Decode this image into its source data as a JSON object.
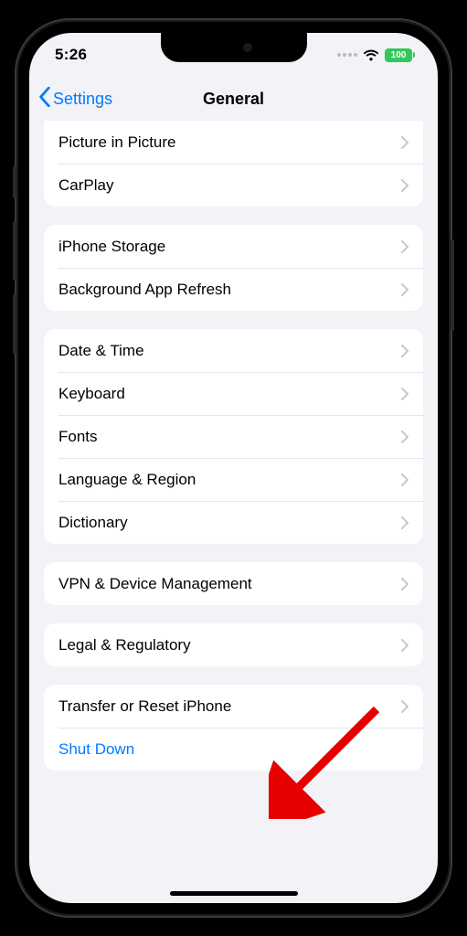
{
  "status": {
    "time": "5:26",
    "battery": "100"
  },
  "nav": {
    "back": "Settings",
    "title": "General"
  },
  "groups": [
    {
      "first": true,
      "items": [
        {
          "label": "Picture in Picture",
          "chevron": true
        },
        {
          "label": "CarPlay",
          "chevron": true
        }
      ]
    },
    {
      "items": [
        {
          "label": "iPhone Storage",
          "chevron": true
        },
        {
          "label": "Background App Refresh",
          "chevron": true
        }
      ]
    },
    {
      "items": [
        {
          "label": "Date & Time",
          "chevron": true
        },
        {
          "label": "Keyboard",
          "chevron": true
        },
        {
          "label": "Fonts",
          "chevron": true
        },
        {
          "label": "Language & Region",
          "chevron": true
        },
        {
          "label": "Dictionary",
          "chevron": true
        }
      ]
    },
    {
      "items": [
        {
          "label": "VPN & Device Management",
          "chevron": true
        }
      ]
    },
    {
      "items": [
        {
          "label": "Legal & Regulatory",
          "chevron": true
        }
      ]
    },
    {
      "items": [
        {
          "label": "Transfer or Reset iPhone",
          "chevron": true
        },
        {
          "label": "Shut Down",
          "chevron": false,
          "link": true
        }
      ]
    }
  ],
  "annotation": {
    "arrow_color": "#e60000"
  }
}
